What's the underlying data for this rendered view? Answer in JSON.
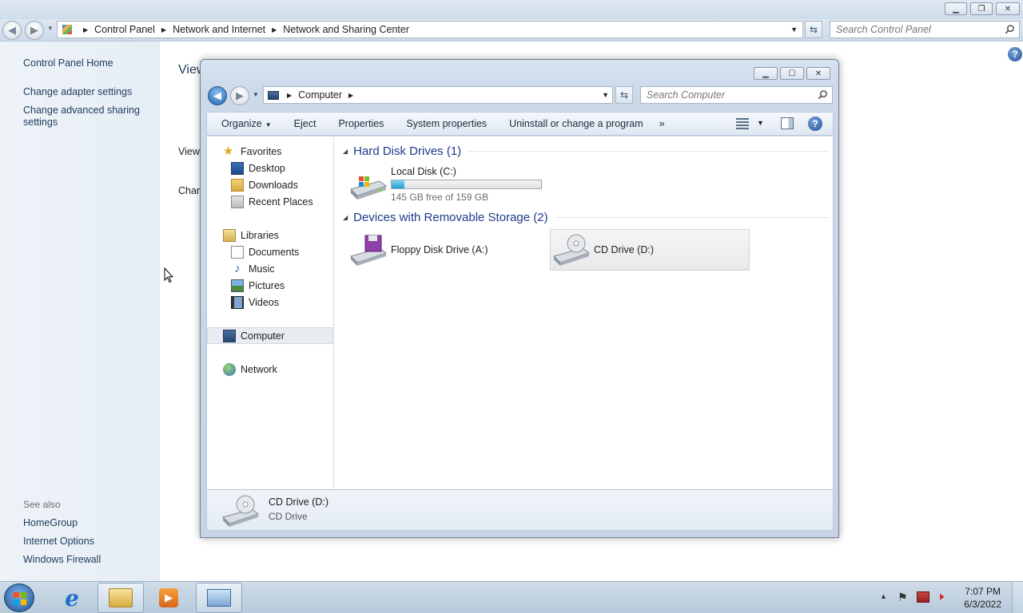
{
  "control_panel": {
    "breadcrumb": [
      "Control Panel",
      "Network and Internet",
      "Network and Sharing Center"
    ],
    "search_placeholder": "Search Control Panel",
    "left_links": [
      "Control Panel Home",
      "Change adapter settings",
      "Change advanced sharing settings"
    ],
    "see_also_label": "See also",
    "see_also_links": [
      "HomeGroup",
      "Internet Options",
      "Windows Firewall"
    ],
    "main_fragments": [
      "View",
      "View",
      "Chan"
    ]
  },
  "explorer": {
    "breadcrumb": [
      "Computer"
    ],
    "search_placeholder": "Search Computer",
    "toolbar": {
      "organize": "Organize",
      "eject": "Eject",
      "properties": "Properties",
      "system_properties": "System properties",
      "uninstall": "Uninstall or change a program",
      "more": "»"
    },
    "nav": {
      "favorites": "Favorites",
      "favorites_items": [
        "Desktop",
        "Downloads",
        "Recent Places"
      ],
      "libraries": "Libraries",
      "libraries_items": [
        "Documents",
        "Music",
        "Pictures",
        "Videos"
      ],
      "computer": "Computer",
      "network": "Network"
    },
    "groups": {
      "hard_disk": "Hard Disk Drives (1)",
      "removable": "Devices with Removable Storage (2)"
    },
    "drives": {
      "c_name": "Local Disk (C:)",
      "c_space": "145 GB free of 159 GB",
      "c_used_fraction": 0.088,
      "a_name": "Floppy Disk Drive (A:)",
      "d_name": "CD Drive (D:)"
    },
    "details": {
      "name": "CD Drive (D:)",
      "type": "CD Drive"
    }
  },
  "taskbar": {
    "time": "7:07 PM",
    "date": "6/3/2022"
  }
}
